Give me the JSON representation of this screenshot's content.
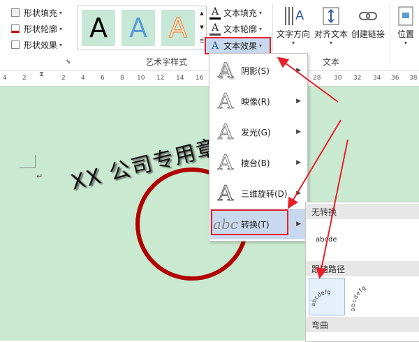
{
  "ribbon": {
    "shape_fill": "形状填充",
    "shape_outline": "形状轮廓",
    "shape_effects": "形状效果",
    "wordart_styles_label": "艺术字样式",
    "wordart_samples": [
      "A",
      "A",
      "A"
    ],
    "text_fill": "文本填充",
    "text_outline": "文本轮廓",
    "text_effects": "文本效果",
    "text_direction": "文字方向",
    "align_text": "对齐文本",
    "create_link": "创建链接",
    "text_group_label": "文本",
    "position": "位置"
  },
  "ruler": [
    "4",
    "2",
    "2",
    "4",
    "6",
    "8",
    "10",
    "12",
    "14",
    "16",
    "28",
    "30",
    "32",
    "34",
    "36",
    "38"
  ],
  "document": {
    "wordart_text": "XX 公司专用章",
    "paragraph_mark": "↵"
  },
  "text_effects_menu": [
    {
      "label": "阴影(S)",
      "glyph": "A"
    },
    {
      "label": "映像(R)",
      "glyph": "A"
    },
    {
      "label": "发光(G)",
      "glyph": "A"
    },
    {
      "label": "棱台(B)",
      "glyph": "A"
    },
    {
      "label": "三维旋转(D)",
      "glyph": "A"
    },
    {
      "label": "转换(T)",
      "glyph": "abc"
    }
  ],
  "transform_submenu": {
    "no_transform": "无转换",
    "no_transform_sample": "abcde",
    "follow_path": "跟随路径",
    "path_sample": "abcdefg",
    "warp": "弯曲"
  },
  "colors": {
    "accent_red": "#e8202a",
    "seal_red": "#b00000",
    "doc_bg": "#c9ead0",
    "menu_highlight": "#c8d9ef"
  }
}
